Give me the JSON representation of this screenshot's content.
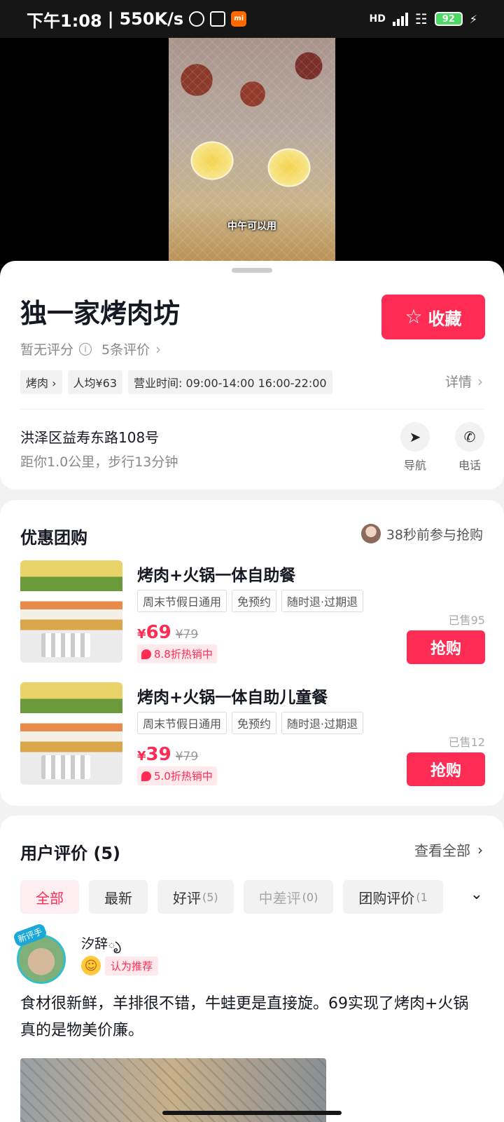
{
  "status_bar": {
    "time": "下午1:08",
    "speed": "550K/s",
    "network": "HD",
    "battery": "92",
    "mi_label": "mi"
  },
  "video": {
    "caption": "中午可以用"
  },
  "shop": {
    "name": "独一家烤肉坊",
    "favorite_label": "收藏",
    "rating": "暂无评分",
    "reviews_link": "5条评价",
    "tags": [
      "烤肉",
      "人均¥63",
      "营业时间: 09:00-14:00 16:00-22:00"
    ],
    "detail_label": "详情",
    "address": "洪泽区益寿东路108号",
    "distance": "距你1.0公里，步行13分钟",
    "nav_label": "导航",
    "call_label": "电话"
  },
  "deals": {
    "title": "优惠团购",
    "activity": "38秒前参与抢购",
    "items": [
      {
        "name": "烤肉+火锅一体自助餐",
        "tags": [
          "周末节假日通用",
          "免预约",
          "随时退·过期退"
        ],
        "currency": "¥",
        "price": "69",
        "original_price": "¥79",
        "promo": "8.8折热销中",
        "sold": "已售95",
        "buy_label": "抢购"
      },
      {
        "name": "烤肉+火锅一体自助儿童餐",
        "tags": [
          "周末节假日通用",
          "免预约",
          "随时退·过期退"
        ],
        "currency": "¥",
        "price": "39",
        "original_price": "¥79",
        "promo": "5.0折热销中",
        "sold": "已售12",
        "buy_label": "抢购"
      }
    ]
  },
  "reviews": {
    "title": "用户评价 (5)",
    "see_all": "查看全部",
    "chips": [
      {
        "label": "全部",
        "count": ""
      },
      {
        "label": "最新",
        "count": ""
      },
      {
        "label": "好评",
        "count": "(5)"
      },
      {
        "label": "中差评",
        "count": "(0)"
      },
      {
        "label": "团购评价",
        "count": "(1"
      }
    ],
    "first": {
      "badge": "新评手",
      "user": "汐辞ృ",
      "recommend": "认为推荐",
      "text": "食材很新鲜，羊排很不错，牛蛙更是直接旋。69实现了烤肉+火锅真的是物美价廉。"
    }
  },
  "colors": {
    "accent": "#fe2c55",
    "promo_bg": "#ffe9ec"
  },
  "icons": [
    "star-icon",
    "info-icon",
    "chevron-right-icon",
    "navigation-icon",
    "phone-icon",
    "chevron-down-icon",
    "smiley-icon"
  ]
}
